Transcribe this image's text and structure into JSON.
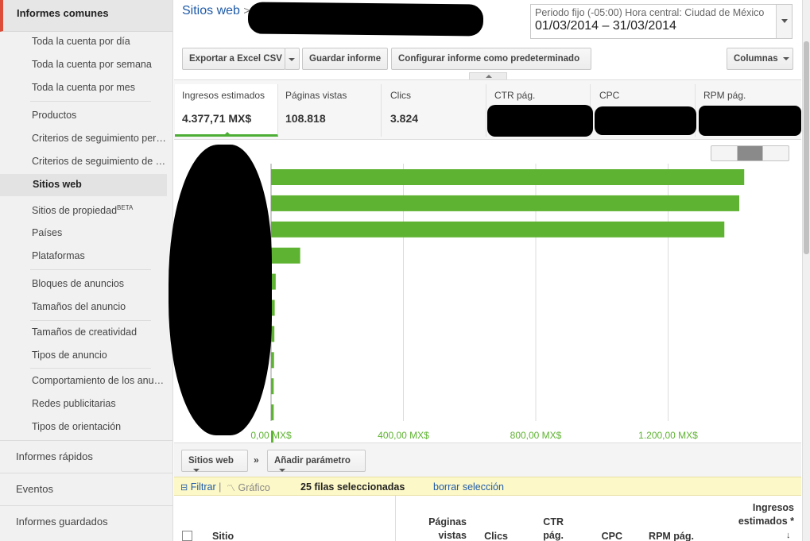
{
  "sidebar": {
    "header": "Informes comunes",
    "items": [
      {
        "label": "Toda la cuenta por día"
      },
      {
        "label": "Toda la cuenta por semana"
      },
      {
        "label": "Toda la cuenta por mes"
      },
      {
        "label": "Productos"
      },
      {
        "label": "Criterios de seguimiento personalizados"
      },
      {
        "label": "Criterios de seguimiento de URL"
      },
      {
        "label": "Sitios web",
        "active": true
      },
      {
        "label": "Sitios de propiedad",
        "badge": "BETA"
      },
      {
        "label": "Países"
      },
      {
        "label": "Plataformas"
      },
      {
        "label": "Bloques de anuncios"
      },
      {
        "label": "Tamaños del anuncio"
      },
      {
        "label": "Tamaños de creatividad"
      },
      {
        "label": "Tipos de anuncio"
      },
      {
        "label": "Comportamiento de los anuncios"
      },
      {
        "label": "Redes publicitarias"
      },
      {
        "label": "Tipos de orientación"
      }
    ],
    "sections": [
      "Informes rápidos",
      "Eventos",
      "Informes guardados"
    ]
  },
  "breadcrumb": {
    "root": "Sitios web",
    "separator": ">"
  },
  "period": {
    "label": "Periodo fijo (-05:00) Hora central: Ciudad de México",
    "range": "01/03/2014 – 31/03/2014"
  },
  "toolbar": {
    "export_label": "Exportar a Excel CSV",
    "save_label": "Guardar informe",
    "default_label": "Configurar informe como predeterminado",
    "columns_label": "Columnas"
  },
  "metrics": [
    {
      "label": "Ingresos estimados",
      "value": "4.377,71 MX$",
      "active": true
    },
    {
      "label": "Páginas vistas",
      "value": "108.818"
    },
    {
      "label": "Clics",
      "value": "3.824"
    },
    {
      "label": "CTR pág.",
      "value": ""
    },
    {
      "label": "CPC",
      "value": ""
    },
    {
      "label": "RPM pág.",
      "value": ""
    }
  ],
  "chart_data": {
    "type": "bar",
    "orientation": "horizontal",
    "series": [
      {
        "values": [
          1430,
          1415,
          1370,
          88,
          14,
          11,
          10,
          9,
          8,
          8,
          7,
          6,
          5
        ]
      }
    ],
    "xlim": [
      0,
      1600
    ],
    "x_ticks": [
      "0,00 MX$",
      "400,00 MX$",
      "800,00 MX$",
      "1.200,00 MX$"
    ],
    "x_tick_values": [
      0,
      400,
      800,
      1200
    ],
    "grid": true,
    "color": "#5fb332"
  },
  "bottom": {
    "dimension_label": "Sitios web",
    "chevron": "»",
    "add_param_label": "Añadir parámetro"
  },
  "filter": {
    "filter_label": "Filtrar",
    "graph_label": "Gráfico",
    "selected_label": "25 filas seleccionadas",
    "clear_label": "borrar selección"
  },
  "table": {
    "col_site": "Sitio",
    "col_pageviews": "Páginas vistas",
    "col_clicks": "Clics",
    "col_ctr": "CTR pág.",
    "col_cpc": "CPC",
    "col_rpm": "RPM pág.",
    "col_revenue": "Ingresos estimados *"
  }
}
